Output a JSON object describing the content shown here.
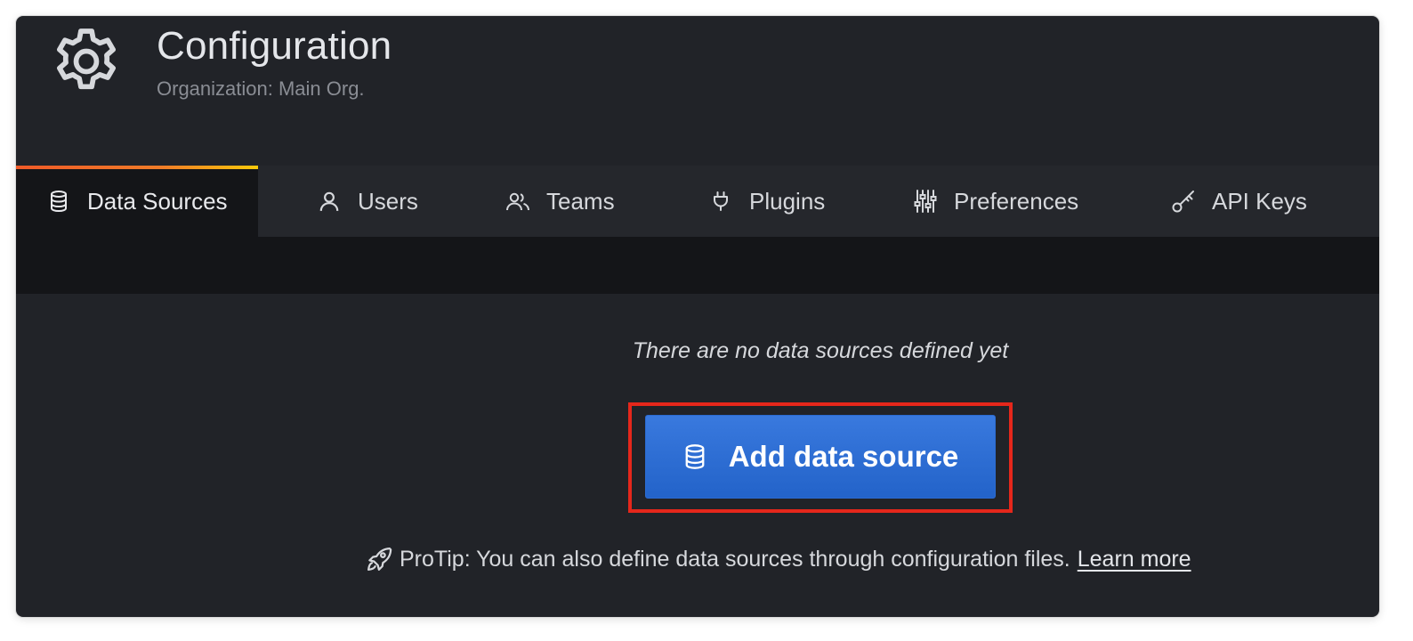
{
  "header": {
    "title": "Configuration",
    "subtitle": "Organization: Main Org.",
    "icon": "gear-icon"
  },
  "tabs": [
    {
      "label": "Data Sources",
      "icon": "database-icon",
      "active": true
    },
    {
      "label": "Users",
      "icon": "user-icon",
      "active": false
    },
    {
      "label": "Teams",
      "icon": "users-icon",
      "active": false
    },
    {
      "label": "Plugins",
      "icon": "plug-icon",
      "active": false
    },
    {
      "label": "Preferences",
      "icon": "sliders-icon",
      "active": false
    },
    {
      "label": "API Keys",
      "icon": "key-icon",
      "active": false
    }
  ],
  "empty_state": {
    "message": "There are no data sources defined yet",
    "button_label": "Add data source",
    "button_icon": "database-icon",
    "protip_text": "ProTip: You can also define data sources through configuration files.",
    "protip_icon": "rocket-icon",
    "learn_more_label": "Learn more"
  },
  "colors": {
    "background": "#212328",
    "tab_band": "#141518",
    "button": "#2f6fd8",
    "highlight": "#e5271b",
    "active_tab_accent_start": "#f05a28",
    "active_tab_accent_end": "#fbca0a"
  }
}
